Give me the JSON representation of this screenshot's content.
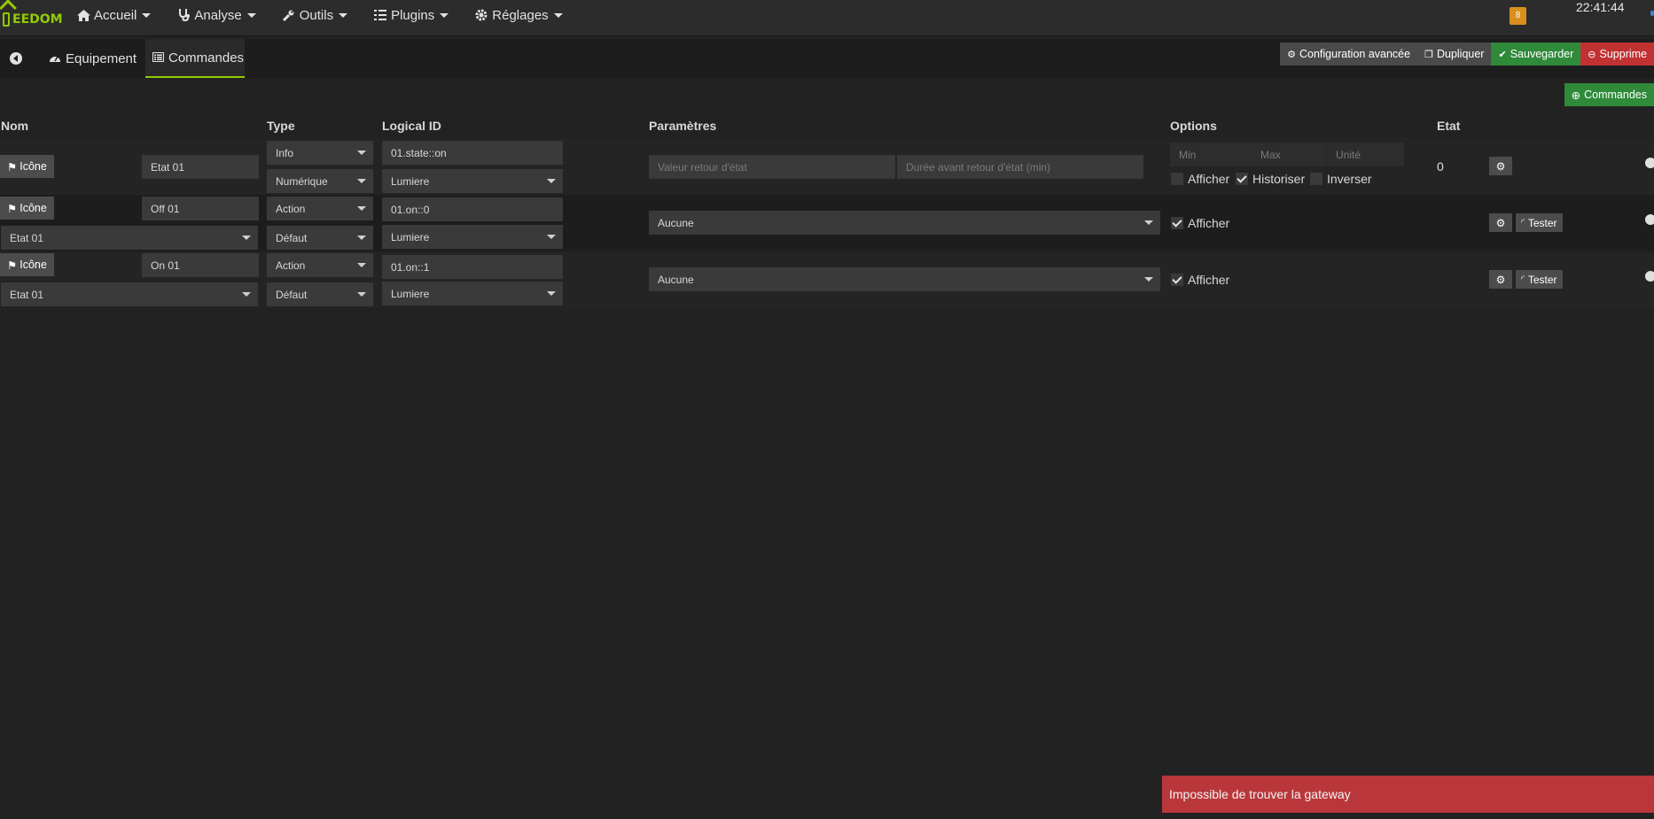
{
  "app": {
    "logo_text": "EEDOM",
    "notifications": "8",
    "clock": "22:41:44"
  },
  "nav": [
    {
      "label": "Accueil",
      "icon": "home-icon"
    },
    {
      "label": "Analyse",
      "icon": "stethoscope-icon"
    },
    {
      "label": "Outils",
      "icon": "wrench-icon"
    },
    {
      "label": "Plugins",
      "icon": "tasks-icon"
    },
    {
      "label": "Réglages",
      "icon": "cogs-icon"
    }
  ],
  "tabs": {
    "equipment": "Equipement",
    "commands": "Commandes"
  },
  "actions": {
    "advanced": "Configuration avancée",
    "duplicate": "Dupliquer",
    "save": "Sauvegarder",
    "delete": "Supprime",
    "add_commands": "Commandes"
  },
  "table": {
    "headers": {
      "name": "Nom",
      "type": "Type",
      "logical_id": "Logical ID",
      "params": "Paramètres",
      "options": "Options",
      "state": "Etat"
    },
    "icon_label": "Icône",
    "rows": [
      {
        "name": "Etat 01",
        "type": "Info",
        "subtype": "Numérique",
        "logical_id": "01.state::on",
        "generic": "Lumiere",
        "param1_placeholder": "Valeur retour d'état",
        "param2_placeholder": "Durée avant retour d'état (min)",
        "min_placeholder": "Min",
        "max_placeholder": "Max",
        "unit_placeholder": "Unité",
        "opt_show": "Afficher",
        "opt_history": "Historiser",
        "opt_invert": "Inverser",
        "state": "0"
      },
      {
        "name": "Off 01",
        "info_link": "Etat 01",
        "type": "Action",
        "subtype": "Défaut",
        "logical_id": "01.on::0",
        "generic": "Lumiere",
        "param_select": "Aucune",
        "opt_show": "Afficher",
        "test": "Tester"
      },
      {
        "name": "On 01",
        "info_link": "Etat 01",
        "type": "Action",
        "subtype": "Défaut",
        "logical_id": "01.on::1",
        "generic": "Lumiere",
        "param_select": "Aucune",
        "opt_show": "Afficher",
        "test": "Tester"
      }
    ]
  },
  "toast": "Impossible de trouver la gateway"
}
